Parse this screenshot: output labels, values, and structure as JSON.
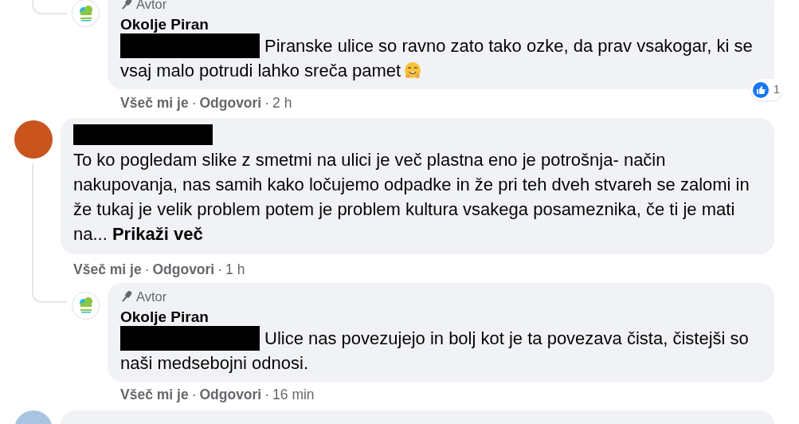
{
  "separator": "·",
  "comments": [
    {
      "kind": "reply",
      "author_badge": "Avtor",
      "author": "Okolje Piran",
      "redacted": true,
      "text": "Piranske ulice so ravno zato tako ozke, da prav vsakogar, ki se vsaj malo potrudi lahko sreča pamet",
      "emoji": true,
      "actions": [
        "Všeč mi je",
        "Odgovori"
      ],
      "time": "2 h",
      "reactions": {
        "count": "1"
      }
    },
    {
      "kind": "top",
      "redacted_name": true,
      "text": "To ko pogledam slike z smetmi na ulici je več plastna eno je potrošnja- način nakupovanja, nas samih kako ločujemo odpadke in že pri teh dveh stvareh se zalomi in že tukaj je velik problem potem je problem kultura vsakega posameznika, če ti je mati na...",
      "more": "Prikaži več",
      "actions": [
        "Všeč mi je",
        "Odgovori"
      ],
      "time": "1 h"
    },
    {
      "kind": "reply",
      "author_badge": "Avtor",
      "author": "Okolje Piran",
      "redacted": true,
      "text": "Ulice nas povezujejo in bolj kot je ta povezava čista, čistejši so naši medsebojni odnosi.",
      "emoji": false,
      "actions": [
        "Všeč mi je",
        "Odgovori"
      ],
      "time": "16 min"
    }
  ]
}
